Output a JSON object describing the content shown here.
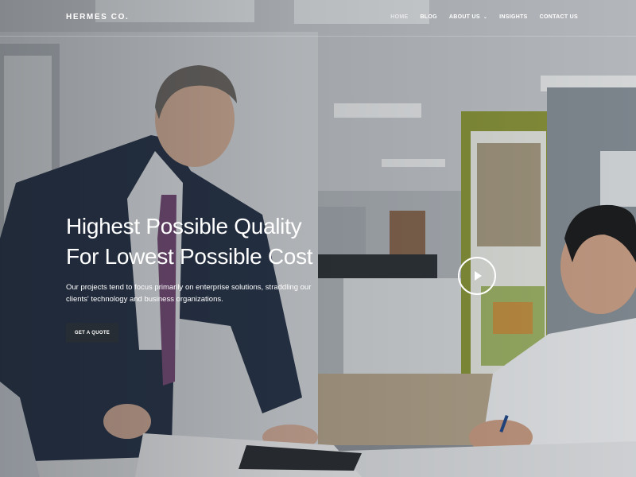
{
  "brand": {
    "logo": "HERMES CO."
  },
  "nav": {
    "items": [
      {
        "label": "HOME",
        "active": true
      },
      {
        "label": "BLOG"
      },
      {
        "label": "ABOUT US",
        "has_dropdown": true
      },
      {
        "label": "INSIGHTS"
      },
      {
        "label": "CONTACT US"
      }
    ],
    "dropdown_icon": "chevron-down-icon"
  },
  "hero": {
    "headline": [
      "Highest Possible Quality",
      "For Lowest Possible Cost"
    ],
    "description": "Our projects tend to focus primarily on enterprise solutions, straddling our clients' technology and business organizations.",
    "cta_label": "GET A QUOTE",
    "play_icon": "play-icon"
  },
  "colors": {
    "text": "#ffffff",
    "cta_background": "#2f353b",
    "overlay": "#14181e"
  }
}
